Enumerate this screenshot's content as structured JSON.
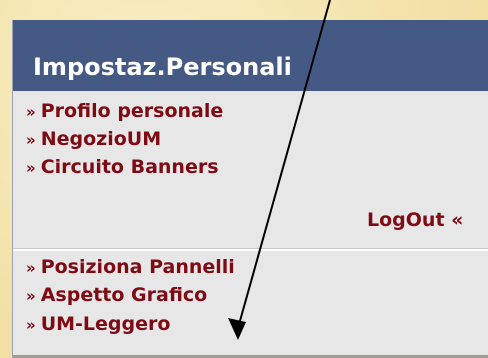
{
  "panel": {
    "title": "Impostaz.Personali",
    "group1": [
      {
        "marker": "»",
        "label": "Profilo personale"
      },
      {
        "marker": "»",
        "label": "NegozioUM"
      },
      {
        "marker": "»",
        "label": "Circuito Banners"
      }
    ],
    "logout": "LogOut «",
    "group2": [
      {
        "marker": "»",
        "label": "Posiziona Pannelli"
      },
      {
        "marker": "»",
        "label": "Aspetto Grafico"
      },
      {
        "marker": "»",
        "label": "UM-Leggero"
      }
    ]
  },
  "colors": {
    "header_bg": "#445a85",
    "link": "#7e0a14",
    "panel_bg": "#e7e7e7",
    "page_bg": "#f6e8b6"
  }
}
